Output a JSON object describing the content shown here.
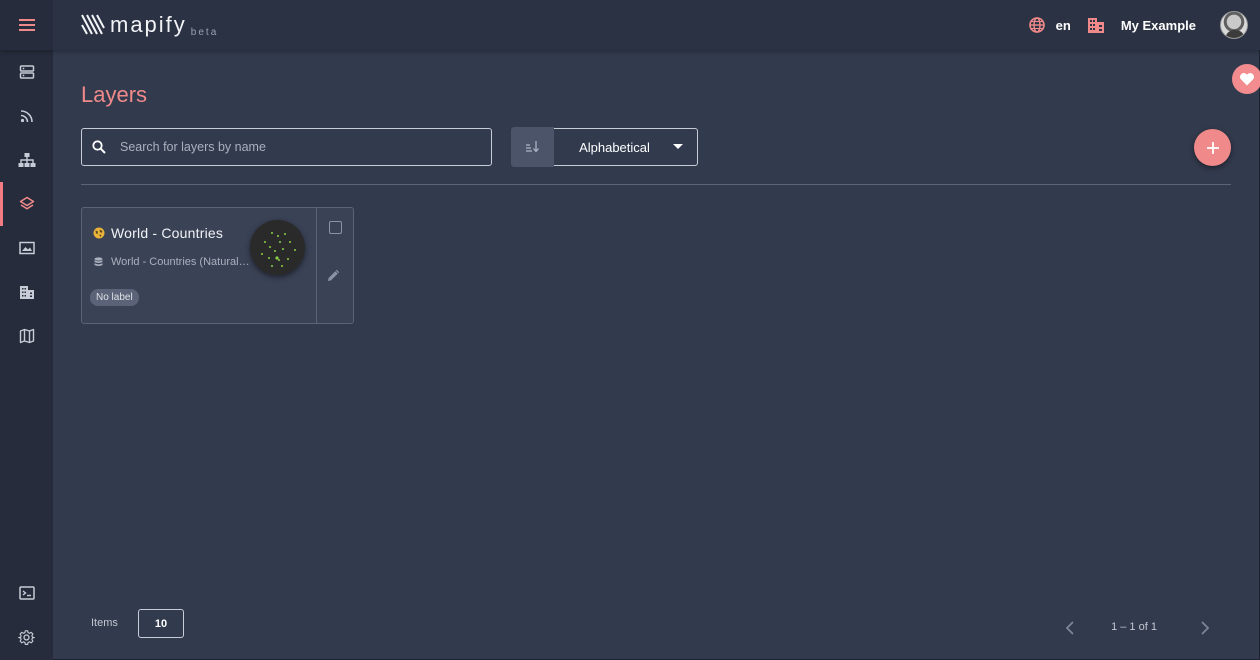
{
  "app": {
    "logo_text": "mapify",
    "logo_badge": "beta"
  },
  "header": {
    "language": "en",
    "organization": "My Example"
  },
  "sidebar": {
    "items": [
      {
        "icon": "storage-icon"
      },
      {
        "icon": "rss-feed-icon"
      },
      {
        "icon": "hierarchy-icon"
      },
      {
        "icon": "layers-icon",
        "active": true
      },
      {
        "icon": "image-icon"
      },
      {
        "icon": "buildings-icon"
      },
      {
        "icon": "map-icon"
      }
    ],
    "bottom_items": [
      {
        "icon": "terminal-icon"
      },
      {
        "icon": "settings-icon"
      }
    ]
  },
  "page": {
    "title": "Layers",
    "search_placeholder": "Search for layers by name",
    "sort_value": "Alphabetical"
  },
  "layers": [
    {
      "title": "World - Countries",
      "source": "World - Countries (Natural Earth)",
      "label": "No label"
    }
  ],
  "pagination": {
    "items_label": "Items",
    "page_size": "10",
    "range": "1 – 1 of 1"
  },
  "colors": {
    "accent": "#f08a8a",
    "background": "#323a4d",
    "sidebar": "#262c3b",
    "topbar": "#2b3243"
  }
}
